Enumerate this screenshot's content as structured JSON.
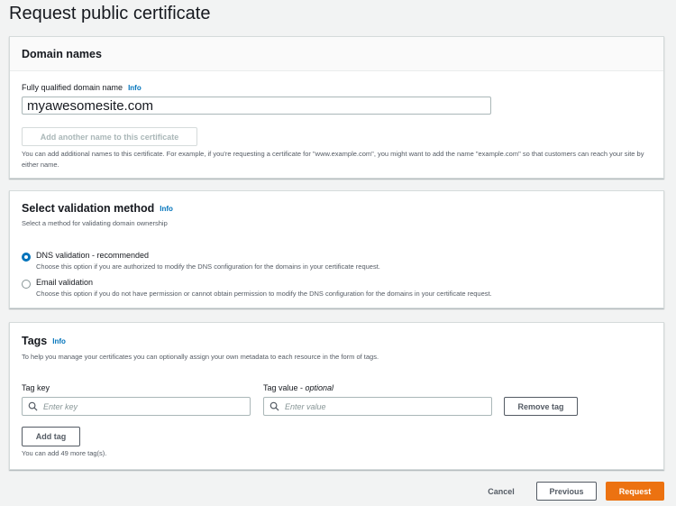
{
  "page": {
    "title": "Request public certificate"
  },
  "domain": {
    "title": "Domain names",
    "field_label": "Fully qualified domain name",
    "info": "Info",
    "value": "myawesomesite.com",
    "add_name_label": "Add another name to this certificate",
    "help": "You can add additional names to this certificate. For example, if you're requesting a certificate for \"www.example.com\", you might want to add the name \"example.com\" so that customers can reach your site by either name."
  },
  "validation": {
    "title": "Select validation method",
    "info": "Info",
    "subtitle": "Select a method for validating domain ownership",
    "options": [
      {
        "label": "DNS validation - recommended",
        "desc": "Choose this option if you are authorized to modify the DNS configuration for the domains in your certificate request.",
        "selected": true
      },
      {
        "label": "Email validation",
        "desc": "Choose this option if you do not have permission or cannot obtain permission to modify the DNS configuration for the domains in your certificate request.",
        "selected": false
      }
    ]
  },
  "tags": {
    "title": "Tags",
    "info": "Info",
    "subtitle": "To help you manage your certificates you can optionally assign your own metadata to each resource in the form of tags.",
    "key_label": "Tag key",
    "value_label": "Tag value - ",
    "value_label_optional": "optional",
    "key_placeholder": "Enter key",
    "value_placeholder": "Enter value",
    "remove_label": "Remove tag",
    "add_label": "Add tag",
    "remaining": "You can add 49 more tag(s)."
  },
  "footer": {
    "cancel": "Cancel",
    "previous": "Previous",
    "request": "Request"
  },
  "colors": {
    "primary": "#ec7211",
    "link": "#0073bb",
    "border": "#aab7b8"
  }
}
